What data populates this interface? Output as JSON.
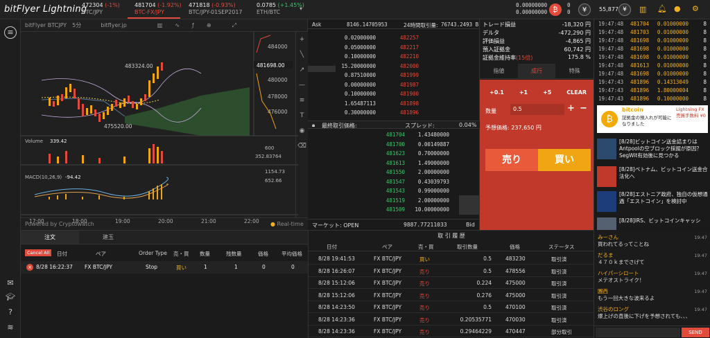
{
  "header": {
    "logo": "bitFlyer Lightning",
    "tickers": [
      {
        "price": "472304",
        "change": "(-1%)",
        "name": "BTC/JPY",
        "active": false
      },
      {
        "price": "481704",
        "change": "(-1.92%)",
        "name": "BTC-FX/JPY",
        "active": true
      },
      {
        "price": "471818",
        "change": "(-0.93%)",
        "name": "BTC/JPY-01SEP2017",
        "active": false
      },
      {
        "price": "0.0785",
        "change": "(+1.45%)",
        "name": "ETH/BTC",
        "active": false
      }
    ],
    "balances": [
      "0.00000000",
      "0.00000000",
      "0",
      "0"
    ],
    "points": "55,877",
    "colors": {
      "accent": "#e24b3b",
      "gold": "#f2b01e",
      "green": "#3cc36a",
      "buy": "#f0a513",
      "sell": "#e85a3a"
    }
  },
  "chart": {
    "source": "bitFlyer BTCJPY",
    "interval": "5分",
    "site": "bitflyer.jp",
    "price_labels": [
      "484000",
      "481698.00",
      "480000",
      "478000",
      "476000"
    ],
    "high_label": "483324.00",
    "low_label": "475520.00",
    "volume_label": "Volume",
    "volume_value": "339.42",
    "volume_axis": [
      "600",
      "352.83764"
    ],
    "macd_label": "MACD(10,26,9)",
    "macd_value": "-94.42",
    "macd_axis": [
      "1154.73",
      "652.66"
    ],
    "times": [
      "17:00",
      "18:00",
      "19:00",
      "20:00",
      "21:00",
      "22:00"
    ],
    "powered": "Powered by Cryptowatch",
    "realtime": "Real-time"
  },
  "book": {
    "ask_label": "Ask",
    "ask_total": "8146.14705953",
    "vol_label": "24時間取引量:",
    "vol_value": "76743.2493 B",
    "asks": [
      {
        "size": "0.02000000",
        "price": "482257"
      },
      {
        "size": "0.05000000",
        "price": "482217"
      },
      {
        "size": "0.10000000",
        "price": "482210"
      },
      {
        "size": "15.20000000",
        "price": "482000"
      },
      {
        "size": "0.87510000",
        "price": "481999"
      },
      {
        "size": "0.00000000",
        "price": "481987"
      },
      {
        "size": "0.10000000",
        "price": "481900"
      },
      {
        "size": "1.65487113",
        "price": "481898"
      },
      {
        "size": "0.30000000",
        "price": "481896"
      }
    ],
    "last_label": "最終取引価格:",
    "last_price": "481704",
    "spread_label": "スプレッド:",
    "spread": "0.04%",
    "bids": [
      {
        "price": "481704",
        "size": "1.43480000"
      },
      {
        "price": "481700",
        "size": "0.00149887"
      },
      {
        "price": "481623",
        "size": "0.70000000"
      },
      {
        "price": "481613",
        "size": "1.49000000"
      },
      {
        "price": "481550",
        "size": "2.00000000"
      },
      {
        "price": "481547",
        "size": "0.43039793"
      },
      {
        "price": "481543",
        "size": "0.99000000"
      },
      {
        "price": "481519",
        "size": "2.00000000"
      },
      {
        "price": "481509",
        "size": "10.00000000"
      }
    ],
    "market_label": "マーケット: OPEN",
    "bid_total": "9887.77211033",
    "bid_label": "Bid"
  },
  "trade": {
    "stats": [
      {
        "k": "トレード損益",
        "v": "-18,320 円"
      },
      {
        "k": "デルタ",
        "v": "-472,290 円"
      },
      {
        "k": "評価損益",
        "v": "-4,865 円"
      },
      {
        "k": "預入証拠金",
        "v": "60,742 円"
      },
      {
        "k": "証拠金維持率",
        "note": "(15倍)",
        "v": "175.8 %"
      }
    ],
    "tabs": [
      "指値",
      "成行",
      "特殊"
    ],
    "quick": [
      "+0.1",
      "+1",
      "+5",
      "CLEAR"
    ],
    "qty_label": "数量",
    "qty_value": "0.5",
    "est_label": "予想価格:",
    "est_value": "237,650 円",
    "sell": "売り",
    "buy": "買い"
  },
  "news": {
    "trades": [
      {
        "t": "19:47:48",
        "p": "481704",
        "q": "0.01000000",
        "u": "8"
      },
      {
        "t": "19:47:48",
        "p": "481703",
        "q": "0.01000000",
        "u": "8"
      },
      {
        "t": "19:47:48",
        "p": "481698",
        "q": "0.01000000",
        "u": "8"
      },
      {
        "t": "19:47:48",
        "p": "481698",
        "q": "0.01000000",
        "u": "8"
      },
      {
        "t": "19:47:48",
        "p": "481698",
        "q": "0.01000000",
        "u": "8"
      },
      {
        "t": "19:47:48",
        "p": "481613",
        "q": "0.01000000",
        "u": "8"
      },
      {
        "t": "19:47:48",
        "p": "481698",
        "q": "0.01000000",
        "u": "8"
      },
      {
        "t": "19:47:43",
        "p": "481896",
        "q": "0.14313049",
        "u": "8"
      },
      {
        "t": "19:47:43",
        "p": "481896",
        "q": "1.80000004",
        "u": "8"
      },
      {
        "t": "19:47:43",
        "p": "481896",
        "q": "0.10000000",
        "u": "8"
      }
    ],
    "banner_brand": "bitcoin",
    "banner_text": "証拠金の預入れが可能になりました",
    "banner_right": "Lightning FX 売買手数料 ¥0",
    "items": [
      {
        "tag": "[8/28]",
        "text": "ビットコイン送金詰まりはAntpoolの空ブロック採掘が原因？SegWit有効後に見つかる"
      },
      {
        "tag": "[8/28]",
        "text": "ベトナム、ビットコイン送金合法化へ"
      },
      {
        "tag": "[8/28]",
        "text": "エストニア政府、独自の仮想通過「エストコイン」を検討中"
      },
      {
        "tag": "[8/28]",
        "text": "IRS、ビットコインキャッシ"
      }
    ]
  },
  "orders": {
    "tabs": [
      "注文",
      "建玉"
    ],
    "cancel_all": "Cancel All",
    "headers": [
      "日付",
      "ペア",
      "Order Type",
      "売・買",
      "数量",
      "残数量",
      "価格",
      "平均価格"
    ],
    "rows": [
      {
        "date": "8/28 16:22:37",
        "pair": "FX BTC/JPY",
        "type": "Stop",
        "side": "買い",
        "qty": "1",
        "remain": "1",
        "price": "0",
        "avg": "0"
      }
    ]
  },
  "history": {
    "title": "取 引 履 歴",
    "headers": [
      "日付",
      "ペア",
      "売・買",
      "取引数量",
      "価格",
      "ステータス"
    ],
    "rows": [
      {
        "date": "8/28 19:41:53",
        "pair": "FX BTC/JPY",
        "side": "買い",
        "qty": "0.5",
        "price": "483230",
        "status": "取引済"
      },
      {
        "date": "8/28 16:26:07",
        "pair": "FX BTC/JPY",
        "side": "売り",
        "qty": "0.5",
        "price": "478556",
        "status": "取引済"
      },
      {
        "date": "8/28 15:12:06",
        "pair": "FX BTC/JPY",
        "side": "売り",
        "qty": "0.224",
        "price": "475000",
        "status": "取引済"
      },
      {
        "date": "8/28 15:12:06",
        "pair": "FX BTC/JPY",
        "side": "売り",
        "qty": "0.276",
        "price": "475000",
        "status": "取引済"
      },
      {
        "date": "8/28 14:23:50",
        "pair": "FX BTC/JPY",
        "side": "売り",
        "qty": "0.5",
        "price": "470100",
        "status": "取引済"
      },
      {
        "date": "8/28 14:23:36",
        "pair": "FX BTC/JPY",
        "side": "売り",
        "qty": "0.20535771",
        "price": "470030",
        "status": "取引済"
      },
      {
        "date": "8/28 14:23:36",
        "pair": "FX BTC/JPY",
        "side": "売り",
        "qty": "0.29464229",
        "price": "470447",
        "status": "部分取引"
      }
    ]
  },
  "chat": {
    "messages": [
      {
        "name": "みーさん",
        "text": "買われてるってことね",
        "time": "19:47"
      },
      {
        "name": "だるま",
        "text": "４７０ｋまでさげて",
        "time": "19:47"
      },
      {
        "name": "ハイパーシロート",
        "text": "メテオストライク！",
        "time": "19:47"
      },
      {
        "name": "園西",
        "text": "もう一回大きな波来るよ",
        "time": "19:47"
      },
      {
        "name": "渋谷のロング",
        "text": "爆上げの直後に下げを予想されても、、、",
        "time": "19:47"
      }
    ],
    "send": "SEND"
  }
}
